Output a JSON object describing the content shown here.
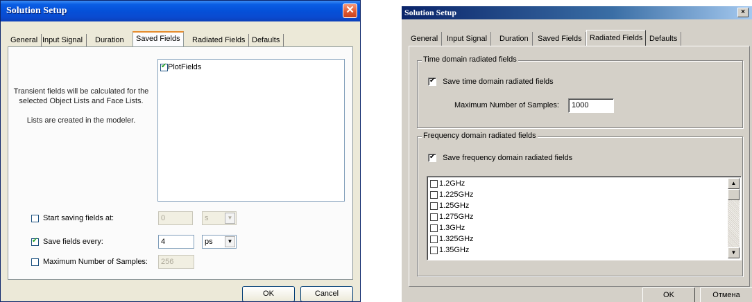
{
  "left_dialog": {
    "title": "Solution Setup",
    "close_glyph": "✕",
    "tabs": [
      "General",
      "Input Signal",
      "Duration",
      "Saved Fields",
      "Radiated Fields",
      "Defaults"
    ],
    "active_tab": "Saved Fields",
    "description_line1": "Transient fields will be calculated for the selected Object Lists and Face Lists.",
    "description_line2": "Lists are created in the modeler.",
    "list_items": [
      {
        "label": "PlotFields",
        "checked": true
      }
    ],
    "start_saving": {
      "label": "Start saving fields at:",
      "checked": false,
      "value": "0",
      "unit": "s",
      "enabled": false
    },
    "save_every": {
      "label": "Save fields every:",
      "checked": true,
      "value": "4",
      "unit": "ps",
      "enabled": true
    },
    "max_samples": {
      "label": "Maximum Number of Samples:",
      "checked": false,
      "value": "256",
      "enabled": false
    },
    "ok_label": "OK",
    "cancel_label": "Cancel"
  },
  "right_dialog": {
    "title": "Solution Setup",
    "close_glyph": "×",
    "tabs": [
      "General",
      "Input Signal",
      "Duration",
      "Saved Fields",
      "Radiated Fields",
      "Defaults"
    ],
    "active_tab": "Radiated Fields",
    "time_group": {
      "caption": "Time domain radiated fields",
      "checkbox_label": "Save time domain radiated fields",
      "checked": true,
      "max_samples_label": "Maximum Number of Samples:",
      "max_samples_value": "1000"
    },
    "freq_group": {
      "caption": "Frequency domain radiated fields",
      "checkbox_label": "Save frequency domain radiated fields",
      "checked": true,
      "frequencies": [
        "1.2GHz",
        "1.225GHz",
        "1.25GHz",
        "1.275GHz",
        "1.3GHz",
        "1.325GHz",
        "1.35GHz"
      ]
    },
    "ok_label": "OK",
    "cancel_label": "Отмена"
  }
}
